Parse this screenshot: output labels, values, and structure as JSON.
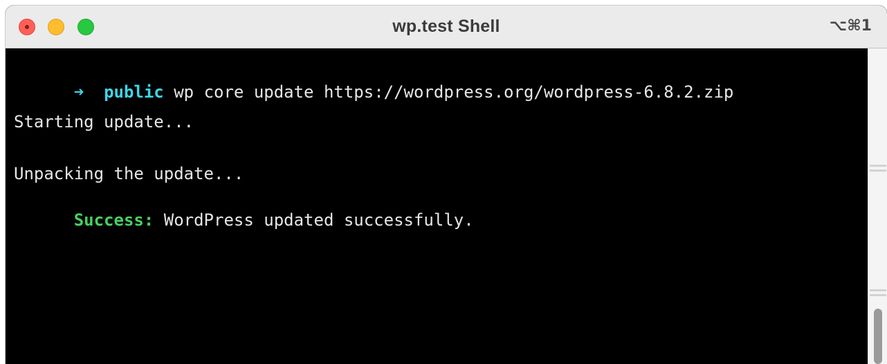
{
  "window": {
    "title": "wp.test Shell",
    "shortcut": "⌥⌘1"
  },
  "terminal": {
    "prompt_arrow": "➜",
    "prompt_dir": "public",
    "command": "wp core update https://wordpress.org/wordpress-6.8.2.zip",
    "output": [
      "Starting update...",
      "Unpacking the update..."
    ],
    "success_label": "Success:",
    "success_message": "WordPress updated successfully."
  },
  "colors": {
    "prompt": "#3fd4e8",
    "success": "#46d160",
    "background": "#000000",
    "text": "#e6e6e6"
  }
}
